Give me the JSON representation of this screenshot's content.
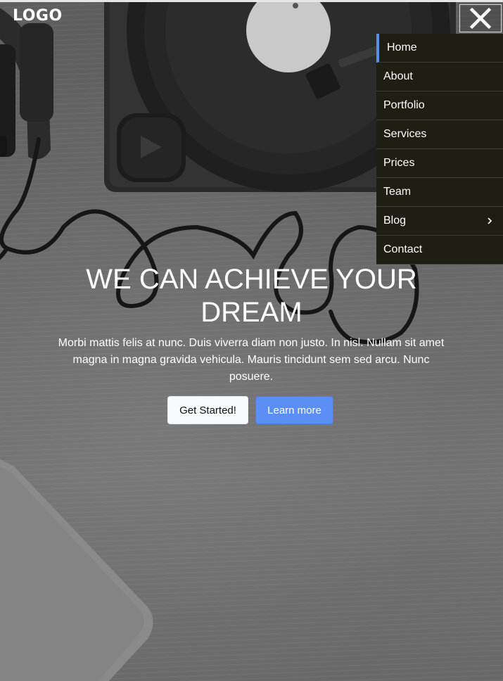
{
  "brand": {
    "logo_text": "LOGO"
  },
  "nav": {
    "close_icon": "close-icon",
    "accent_color": "#5b8def",
    "menu_background": "#1f1e12",
    "items": [
      {
        "label": "Home",
        "active": true
      },
      {
        "label": "About"
      },
      {
        "label": "Portfolio"
      },
      {
        "label": "Services"
      },
      {
        "label": "Prices"
      },
      {
        "label": "Team"
      },
      {
        "label": "Blog",
        "has_submenu": true,
        "submenu_icon": "chevron-right-icon"
      },
      {
        "label": "Contact"
      }
    ]
  },
  "hero": {
    "headline": "WE CAN ACHIEVE YOUR DREAM",
    "subtext": "Morbi mattis felis at nunc. Duis viverra diam non justo. In nisl. Nullam sit amet magna in magna gravida vehicula. Mauris tincidunt sem sed arcu. Nunc posuere.",
    "primary_button": "Get Started!",
    "secondary_button": "Learn more",
    "secondary_button_color": "#5b8ff5"
  }
}
